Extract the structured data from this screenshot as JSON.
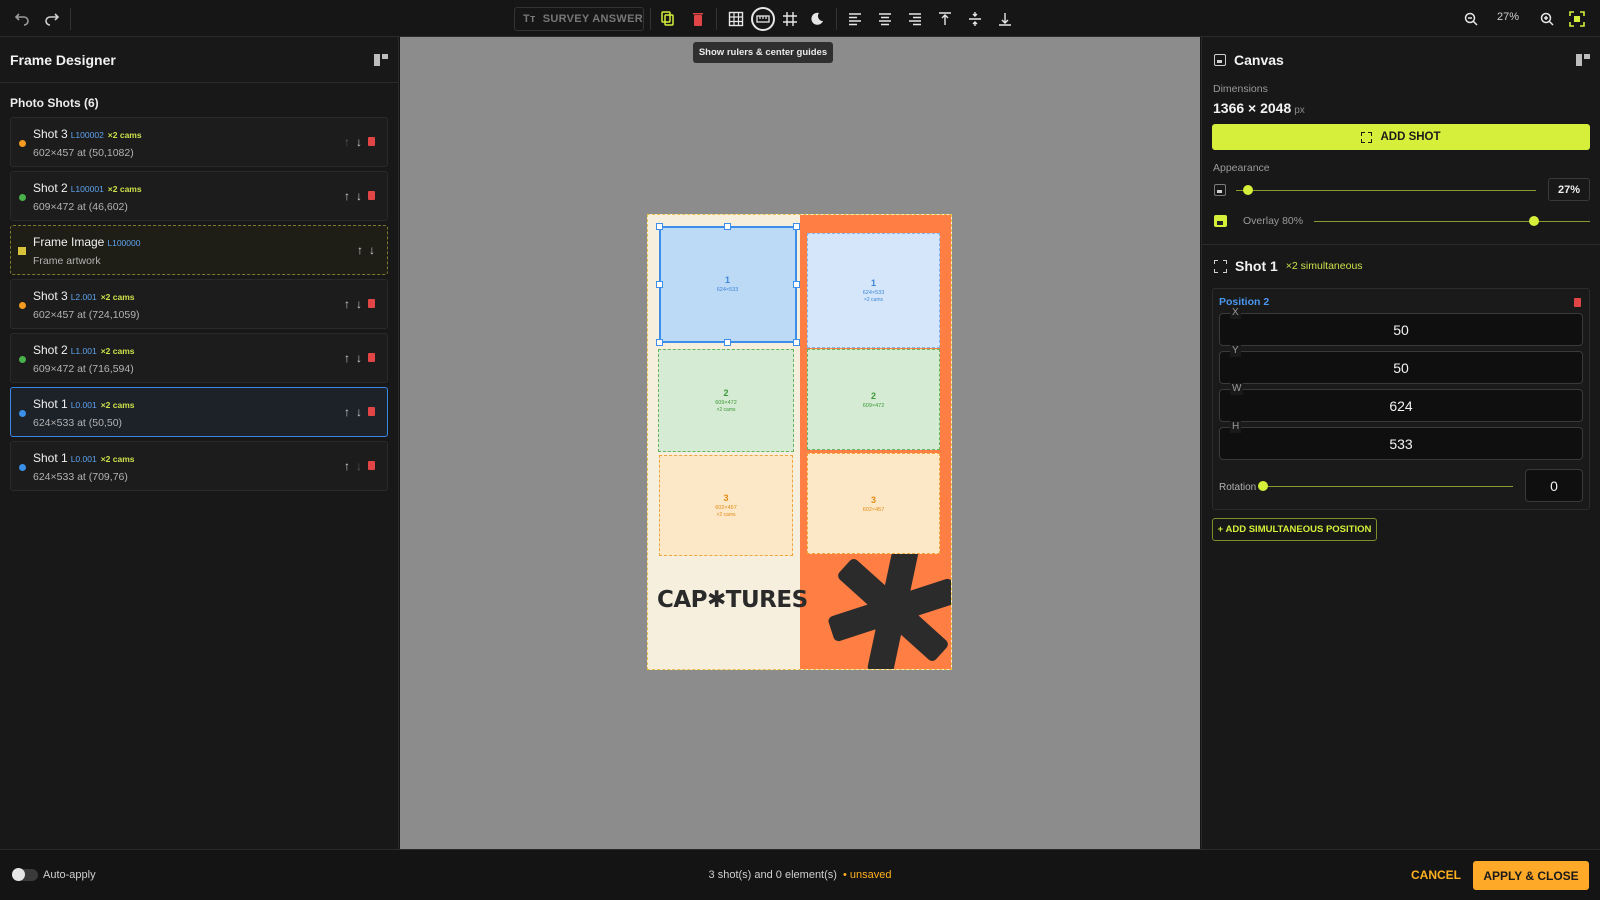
{
  "toolbar": {
    "survey_label": "SURVEY ANSWER",
    "tooltip": "Show rulers & center guides",
    "zoom": "27%"
  },
  "left_panel": {
    "title": "Frame Designer",
    "section_title": "Photo Shots (6)",
    "shots": [
      {
        "name": "Shot 3",
        "id": "L100002",
        "cams": "×2 cams",
        "meta": "602×457 at (50,1082)",
        "color": "#f39a1f"
      },
      {
        "name": "Shot 2",
        "id": "L100001",
        "cams": "×2 cams",
        "meta": "609×472 at (46,602)",
        "color": "#49b14a"
      },
      {
        "name": "Frame Image",
        "id": "L100000",
        "cams": "",
        "meta": "Frame artwork",
        "color": "#d8c23c"
      },
      {
        "name": "Shot 3",
        "id": "L2.001",
        "cams": "×2 cams",
        "meta": "602×457 at (724,1059)",
        "color": "#f39a1f"
      },
      {
        "name": "Shot 2",
        "id": "L1.001",
        "cams": "×2 cams",
        "meta": "609×472 at (716,594)",
        "color": "#49b14a"
      },
      {
        "name": "Shot 1",
        "id": "L0.001",
        "cams": "×2 cams",
        "meta": "624×533 at (50,50)",
        "color": "#3a8fe8"
      },
      {
        "name": "Shot 1",
        "id": "L0.001",
        "cams": "×2 cams",
        "meta": "624×533 at (709,76)",
        "color": "#3a8fe8"
      }
    ]
  },
  "canvas": {
    "brand": "CAP✱TURES",
    "slots": {
      "s1_num": "1",
      "s1_dim": "624×533",
      "s1r_dim": "624×533",
      "s1r_cams": "×2 cams",
      "s2_num": "2",
      "s2_dim": "609×472",
      "s2_cams": "×2 cams",
      "s2r_dim": "609×472",
      "s3_num": "3",
      "s3_dim": "602×457",
      "s3_cams": "×2 cams",
      "s3r_dim": "602×457"
    }
  },
  "right_panel": {
    "title": "Canvas",
    "dimensions_label": "Dimensions",
    "dimensions": "1366 × 2048",
    "unit": "px",
    "add_shot": "ADD SHOT",
    "appearance_label": "Appearance",
    "zoom_value": "27%",
    "overlay_label": "Overlay 80%",
    "shot_title": "Shot 1",
    "shot_sub": "×2 simultaneous",
    "position_title": "Position 2",
    "fields": {
      "x_label": "X",
      "x": "50",
      "y_label": "Y",
      "y": "50",
      "w_label": "W",
      "w": "624",
      "h_label": "H",
      "h": "533"
    },
    "rotation_label": "Rotation",
    "rotation": "0",
    "add_sim": "+ ADD SIMULTANEOUS POSITION"
  },
  "bottom": {
    "auto_apply": "Auto-apply",
    "status": "3 shot(s) and 0 element(s)",
    "unsaved": "• unsaved",
    "cancel": "CANCEL",
    "apply": "APPLY & CLOSE"
  }
}
